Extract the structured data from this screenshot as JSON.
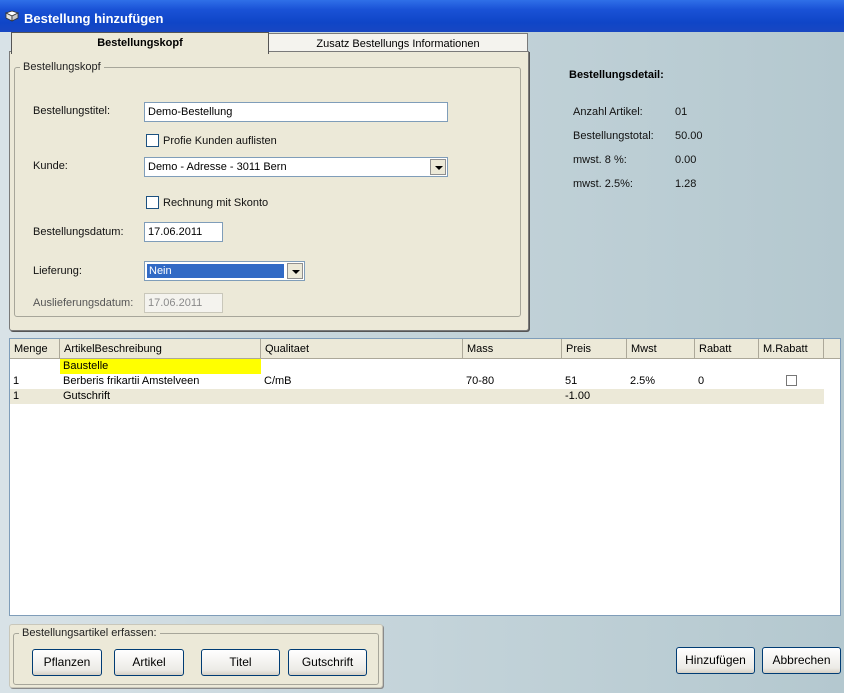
{
  "window": {
    "title": "Bestellung hinzufügen"
  },
  "tabs": [
    {
      "label": "Bestellungskopf",
      "active": true
    },
    {
      "label": "Zusatz Bestellungs Informationen",
      "active": false
    }
  ],
  "form": {
    "group_label": "Bestellungskopf",
    "title_label": "Bestellungstitel:",
    "title_value": "Demo-Bestellung",
    "profi_checkbox_label": "Profie Kunden auflisten",
    "customer_label": "Kunde:",
    "customer_value": "Demo - Adresse - 3011 Bern",
    "skonto_checkbox_label": "Rechnung mit Skonto",
    "date_label": "Bestellungsdatum:",
    "date_value": "17.06.2011",
    "delivery_label": "Lieferung:",
    "delivery_value": "Nein",
    "delivery_date_label": "Auslieferungsdatum:",
    "delivery_date_value": "17.06.2011"
  },
  "detail": {
    "heading": "Bestellungsdetail:",
    "rows": [
      {
        "label": "Anzahl Artikel:",
        "value": "01"
      },
      {
        "label": "Bestellungstotal:",
        "value": "50.00"
      },
      {
        "label": "mwst. 8 %:",
        "value": "0.00"
      },
      {
        "label": "mwst. 2.5%:",
        "value": "1.28"
      }
    ]
  },
  "grid": {
    "columns": [
      "Menge",
      "ArtikelBeschreibung",
      "Qualitaet",
      "Mass",
      "Preis",
      "Mwst",
      "Rabatt",
      "M.Rabatt"
    ],
    "rows": [
      {
        "menge": "",
        "beschreibung": "Baustelle",
        "qualitaet": "",
        "mass": "",
        "preis": "",
        "mwst": "",
        "rabatt": ""
      },
      {
        "menge": "1",
        "beschreibung": "Berberis frikartii Amstelveen",
        "qualitaet": "C/mB",
        "mass": "70-80",
        "preis": "51",
        "mwst": "2.5%",
        "rabatt": "0"
      },
      {
        "menge": "1",
        "beschreibung": "Gutschrift",
        "qualitaet": "",
        "mass": "",
        "preis": "-1.00",
        "mwst": "",
        "rabatt": ""
      }
    ]
  },
  "article_group": {
    "label": "Bestellungsartikel erfassen:",
    "buttons": [
      "Pflanzen",
      "Artikel",
      "Titel",
      "Gutschrift"
    ]
  },
  "actions": {
    "add_label": "Hinzufügen",
    "cancel_label": "Abbrechen"
  },
  "colors": {
    "titlebar": "#0f45c7",
    "highlight": "#ffff00",
    "selection": "#316ac5"
  }
}
